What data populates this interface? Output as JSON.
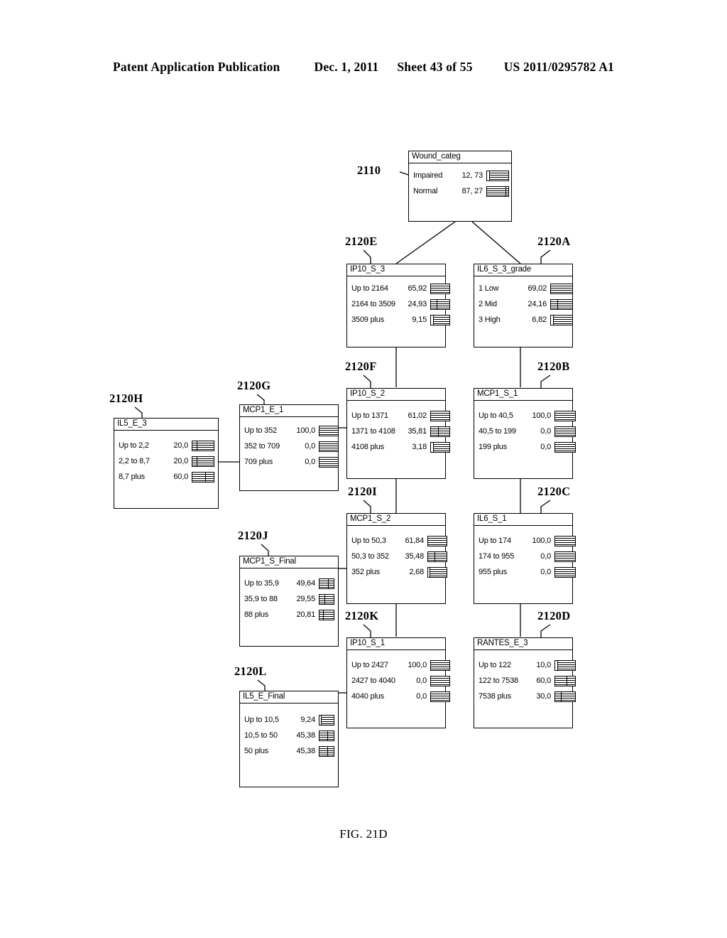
{
  "header": {
    "publication": "Patent Application Publication",
    "date": "Dec. 1, 2011",
    "sheet": "Sheet 43 of 55",
    "patent_number": "US 2011/0295782 A1"
  },
  "figure": {
    "caption": "FIG. 21D"
  },
  "ref_labels": {
    "root": "2110",
    "a": "2120A",
    "b": "2120B",
    "c": "2120C",
    "d": "2120D",
    "e": "2120E",
    "f": "2120F",
    "g": "2120G",
    "h": "2120H",
    "i": "2120I",
    "j": "2120J",
    "k": "2120K",
    "l": "2120L"
  },
  "nodes": {
    "root": {
      "id": "2110",
      "title": "Wound_categ",
      "rows": [
        {
          "state": "Impaired",
          "pct": "12, 73"
        },
        {
          "state": "Normal",
          "pct": "87, 27"
        }
      ]
    },
    "e": {
      "id": "2120E",
      "title": "IP10_S_3",
      "rows": [
        {
          "state": "Up to 2164",
          "pct": "65,92"
        },
        {
          "state": "2164 to 3509",
          "pct": "24,93"
        },
        {
          "state": "3509 plus",
          "pct": "9,15"
        }
      ]
    },
    "a": {
      "id": "2120A",
      "title": "IL6_S_3_grade",
      "rows": [
        {
          "state": "1 Low",
          "pct": "69,02"
        },
        {
          "state": "2 Mid",
          "pct": "24,16"
        },
        {
          "state": "3 High",
          "pct": "6,82"
        }
      ]
    },
    "f": {
      "id": "2120F",
      "title": "IP10_S_2",
      "rows": [
        {
          "state": "Up to 1371",
          "pct": "61,02"
        },
        {
          "state": "1371 to 4108",
          "pct": "35,81"
        },
        {
          "state": "4108 plus",
          "pct": "3,18"
        }
      ]
    },
    "b": {
      "id": "2120B",
      "title": "MCP1_S_1",
      "rows": [
        {
          "state": "Up to 40,5",
          "pct": "100,0"
        },
        {
          "state": "40,5 to 199",
          "pct": "0,0"
        },
        {
          "state": "199 plus",
          "pct": "0,0"
        }
      ]
    },
    "g": {
      "id": "2120G",
      "title": "MCP1_E_1",
      "rows": [
        {
          "state": "Up to 352",
          "pct": "100,0"
        },
        {
          "state": "352 to 709",
          "pct": "0,0"
        },
        {
          "state": "709 plus",
          "pct": "0,0"
        }
      ]
    },
    "h": {
      "id": "2120H",
      "title": "IL5_E_3",
      "rows": [
        {
          "state": "Up to 2,2",
          "pct": "20,0"
        },
        {
          "state": "2,2 to 8,7",
          "pct": "20,0"
        },
        {
          "state": "8,7 plus",
          "pct": "60,0"
        }
      ]
    },
    "i": {
      "id": "2120I",
      "title": "MCP1_S_2",
      "rows": [
        {
          "state": "Up to 50,3",
          "pct": "61,84"
        },
        {
          "state": "50,3 to 352",
          "pct": "35,48"
        },
        {
          "state": "352 plus",
          "pct": "2,68"
        }
      ]
    },
    "c": {
      "id": "2120C",
      "title": "IL6_S_1",
      "rows": [
        {
          "state": "Up to 174",
          "pct": "100,0"
        },
        {
          "state": "174 to 955",
          "pct": "0,0"
        },
        {
          "state": "955 plus",
          "pct": "0,0"
        }
      ]
    },
    "j": {
      "id": "2120J",
      "title": "MCP1_S_Final",
      "rows": [
        {
          "state": "Up to 35,9",
          "pct": "49,64"
        },
        {
          "state": "35,9 to 88",
          "pct": "29,55"
        },
        {
          "state": "88 plus",
          "pct": "20,81"
        }
      ]
    },
    "k": {
      "id": "2120K",
      "title": "IP10_S_1",
      "rows": [
        {
          "state": "Up to 2427",
          "pct": "100,0"
        },
        {
          "state": "2427 to 4040",
          "pct": "0,0"
        },
        {
          "state": "4040 plus",
          "pct": "0,0"
        }
      ]
    },
    "d": {
      "id": "2120D",
      "title": "RANTES_E_3",
      "rows": [
        {
          "state": "Up to 122",
          "pct": "10,0"
        },
        {
          "state": "122 to 7538",
          "pct": "60,0"
        },
        {
          "state": "7538 plus",
          "pct": "30,0"
        }
      ]
    },
    "l": {
      "id": "2120L",
      "title": "IL5_E_Final",
      "rows": [
        {
          "state": "Up to 10,5",
          "pct": "9,24"
        },
        {
          "state": "10,5 to 50",
          "pct": "45,38"
        },
        {
          "state": "50 plus",
          "pct": "45,38"
        }
      ]
    }
  }
}
